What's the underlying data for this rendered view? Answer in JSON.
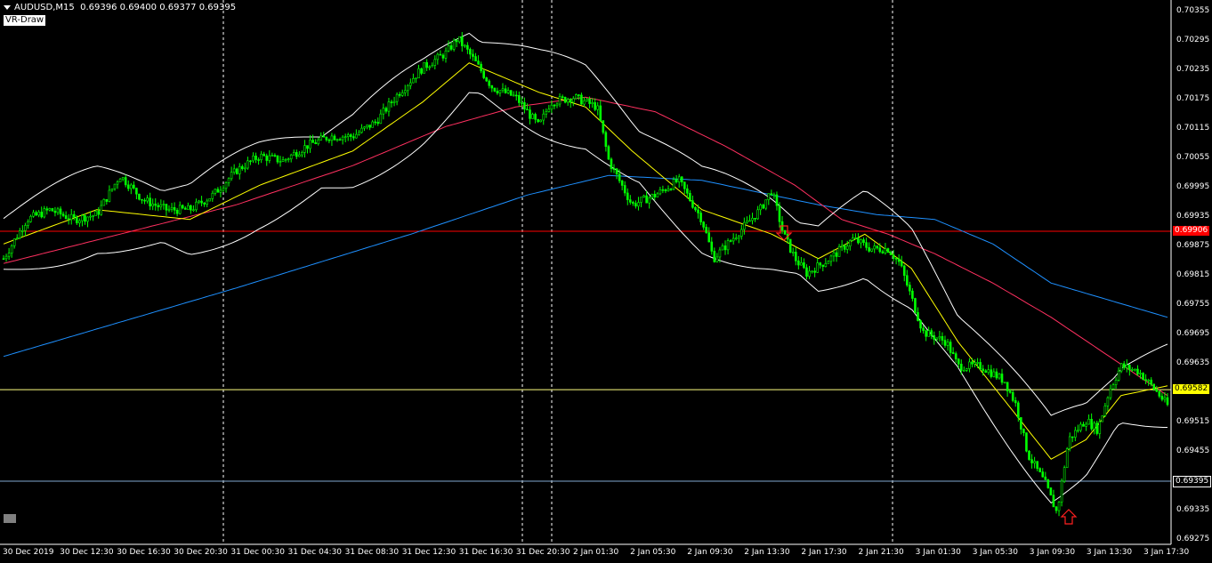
{
  "header": {
    "symbol": "AUDUSD,M15",
    "ohlc": "0.69396 0.69400 0.69377 0.69395",
    "indicator_badge": "VR-Draw"
  },
  "price_axis": {
    "ticks": [
      "0.70355",
      "0.70295",
      "0.70235",
      "0.70175",
      "0.70115",
      "0.70055",
      "0.69995",
      "0.69935",
      "0.69875",
      "0.69815",
      "0.69755",
      "0.69695",
      "0.69635",
      "0.69575",
      "0.69515",
      "0.69455",
      "0.69395",
      "0.69335",
      "0.69275"
    ],
    "labels": [
      {
        "text": "0.69906",
        "bg": "#ff0000",
        "fg": "#ffffff"
      },
      {
        "text": "0.69582",
        "bg": "#ffff00",
        "fg": "#000000"
      },
      {
        "text": "0.69395",
        "bg": "#000000",
        "fg": "#ffffff"
      }
    ]
  },
  "time_axis": {
    "ticks": [
      "30 Dec 2019",
      "30 Dec 12:30",
      "30 Dec 16:30",
      "30 Dec 20:30",
      "31 Dec 00:30",
      "31 Dec 04:30",
      "31 Dec 08:30",
      "31 Dec 12:30",
      "31 Dec 16:30",
      "31 Dec 20:30",
      "2 Jan 01:30",
      "2 Jan 05:30",
      "2 Jan 09:30",
      "2 Jan 13:30",
      "2 Jan 17:30",
      "2 Jan 21:30",
      "3 Jan 01:30",
      "3 Jan 05:30",
      "3 Jan 09:30",
      "3 Jan 13:30",
      "3 Jan 17:30"
    ]
  },
  "colors": {
    "candle": "#00ff00",
    "bands": "#ffffff",
    "ma_fast": "#ffff00",
    "ma_mid": "#ff3060",
    "ma_slow": "#1e90ff",
    "hline_red": "#ff0000",
    "hline_yellow": "#ffff80",
    "hline_blue": "#7fa8d0",
    "separator": "#ffffff"
  },
  "chart_data": {
    "type": "candlestick",
    "symbol": "AUDUSD",
    "timeframe": "M15",
    "ylim": [
      0.6926,
      0.7037
    ],
    "horizontal_lines": [
      0.69906,
      0.69582,
      0.69395
    ],
    "close_path": [
      [
        0,
        0.6985
      ],
      [
        0.02,
        0.6993
      ],
      [
        0.04,
        0.6995
      ],
      [
        0.06,
        0.6993
      ],
      [
        0.08,
        0.6994
      ],
      [
        0.1,
        0.7002
      ],
      [
        0.12,
        0.6997
      ],
      [
        0.14,
        0.6995
      ],
      [
        0.16,
        0.6995
      ],
      [
        0.18,
        0.6998
      ],
      [
        0.2,
        0.7003
      ],
      [
        0.22,
        0.7006
      ],
      [
        0.24,
        0.7005
      ],
      [
        0.26,
        0.7008
      ],
      [
        0.28,
        0.701
      ],
      [
        0.3,
        0.701
      ],
      [
        0.32,
        0.7013
      ],
      [
        0.34,
        0.7019
      ],
      [
        0.36,
        0.7024
      ],
      [
        0.38,
        0.7027
      ],
      [
        0.39,
        0.703
      ],
      [
        0.4,
        0.7027
      ],
      [
        0.42,
        0.702
      ],
      [
        0.44,
        0.7018
      ],
      [
        0.46,
        0.7012
      ],
      [
        0.47,
        0.7017
      ],
      [
        0.49,
        0.7018
      ],
      [
        0.51,
        0.7016
      ],
      [
        0.52,
        0.7005
      ],
      [
        0.54,
        0.6996
      ],
      [
        0.56,
        0.6998
      ],
      [
        0.58,
        0.7001
      ],
      [
        0.6,
        0.6993
      ],
      [
        0.61,
        0.6985
      ],
      [
        0.63,
        0.699
      ],
      [
        0.65,
        0.6995
      ],
      [
        0.66,
        0.6999
      ],
      [
        0.67,
        0.699
      ],
      [
        0.68,
        0.6985
      ],
      [
        0.69,
        0.6982
      ],
      [
        0.71,
        0.6985
      ],
      [
        0.73,
        0.6989
      ],
      [
        0.745,
        0.6987
      ],
      [
        0.76,
        0.6987
      ],
      [
        0.77,
        0.6984
      ],
      [
        0.78,
        0.6977
      ],
      [
        0.79,
        0.697
      ],
      [
        0.81,
        0.6968
      ],
      [
        0.82,
        0.6963
      ],
      [
        0.84,
        0.6963
      ],
      [
        0.86,
        0.696
      ],
      [
        0.87,
        0.6955
      ],
      [
        0.88,
        0.6945
      ],
      [
        0.895,
        0.6939
      ],
      [
        0.905,
        0.6933
      ],
      [
        0.915,
        0.6948
      ],
      [
        0.93,
        0.6952
      ],
      [
        0.94,
        0.695
      ],
      [
        0.95,
        0.6958
      ],
      [
        0.96,
        0.6963
      ],
      [
        0.975,
        0.6962
      ],
      [
        0.99,
        0.6958
      ],
      [
        1,
        0.6955
      ]
    ],
    "moving_averages": [
      {
        "name": "slow",
        "points": [
          [
            0,
            0.6965
          ],
          [
            0.2,
            0.6979
          ],
          [
            0.35,
            0.699
          ],
          [
            0.45,
            0.6998
          ],
          [
            0.52,
            0.7002
          ],
          [
            0.6,
            0.7001
          ],
          [
            0.7,
            0.6996
          ],
          [
            0.75,
            0.6994
          ],
          [
            0.8,
            0.6993
          ],
          [
            0.85,
            0.6988
          ],
          [
            0.9,
            0.698
          ],
          [
            1,
            0.6973
          ]
        ]
      },
      {
        "name": "mid",
        "points": [
          [
            0,
            0.6984
          ],
          [
            0.1,
            0.699
          ],
          [
            0.2,
            0.6996
          ],
          [
            0.3,
            0.7004
          ],
          [
            0.38,
            0.7012
          ],
          [
            0.44,
            0.7016
          ],
          [
            0.5,
            0.7018
          ],
          [
            0.56,
            0.7015
          ],
          [
            0.62,
            0.7008
          ],
          [
            0.68,
            0.7
          ],
          [
            0.72,
            0.6993
          ],
          [
            0.76,
            0.699
          ],
          [
            0.8,
            0.6986
          ],
          [
            0.85,
            0.698
          ],
          [
            0.9,
            0.6973
          ],
          [
            0.95,
            0.6965
          ],
          [
            1,
            0.6957
          ]
        ]
      },
      {
        "name": "fast",
        "points": [
          [
            0,
            0.6988
          ],
          [
            0.08,
            0.6995
          ],
          [
            0.16,
            0.6993
          ],
          [
            0.22,
            0.7
          ],
          [
            0.3,
            0.7007
          ],
          [
            0.36,
            0.7017
          ],
          [
            0.4,
            0.7025
          ],
          [
            0.46,
            0.7019
          ],
          [
            0.5,
            0.7016
          ],
          [
            0.54,
            0.7007
          ],
          [
            0.6,
            0.6995
          ],
          [
            0.66,
            0.699
          ],
          [
            0.7,
            0.6985
          ],
          [
            0.74,
            0.699
          ],
          [
            0.78,
            0.6983
          ],
          [
            0.82,
            0.6968
          ],
          [
            0.86,
            0.6956
          ],
          [
            0.9,
            0.6944
          ],
          [
            0.93,
            0.6948
          ],
          [
            0.96,
            0.6957
          ],
          [
            1,
            0.6959
          ]
        ]
      }
    ],
    "bollinger_width": 0.00065,
    "vertical_separators_at": [
      "31 Dec 00:30",
      "31 Dec 20:30",
      "2 Jan 21:30"
    ]
  }
}
